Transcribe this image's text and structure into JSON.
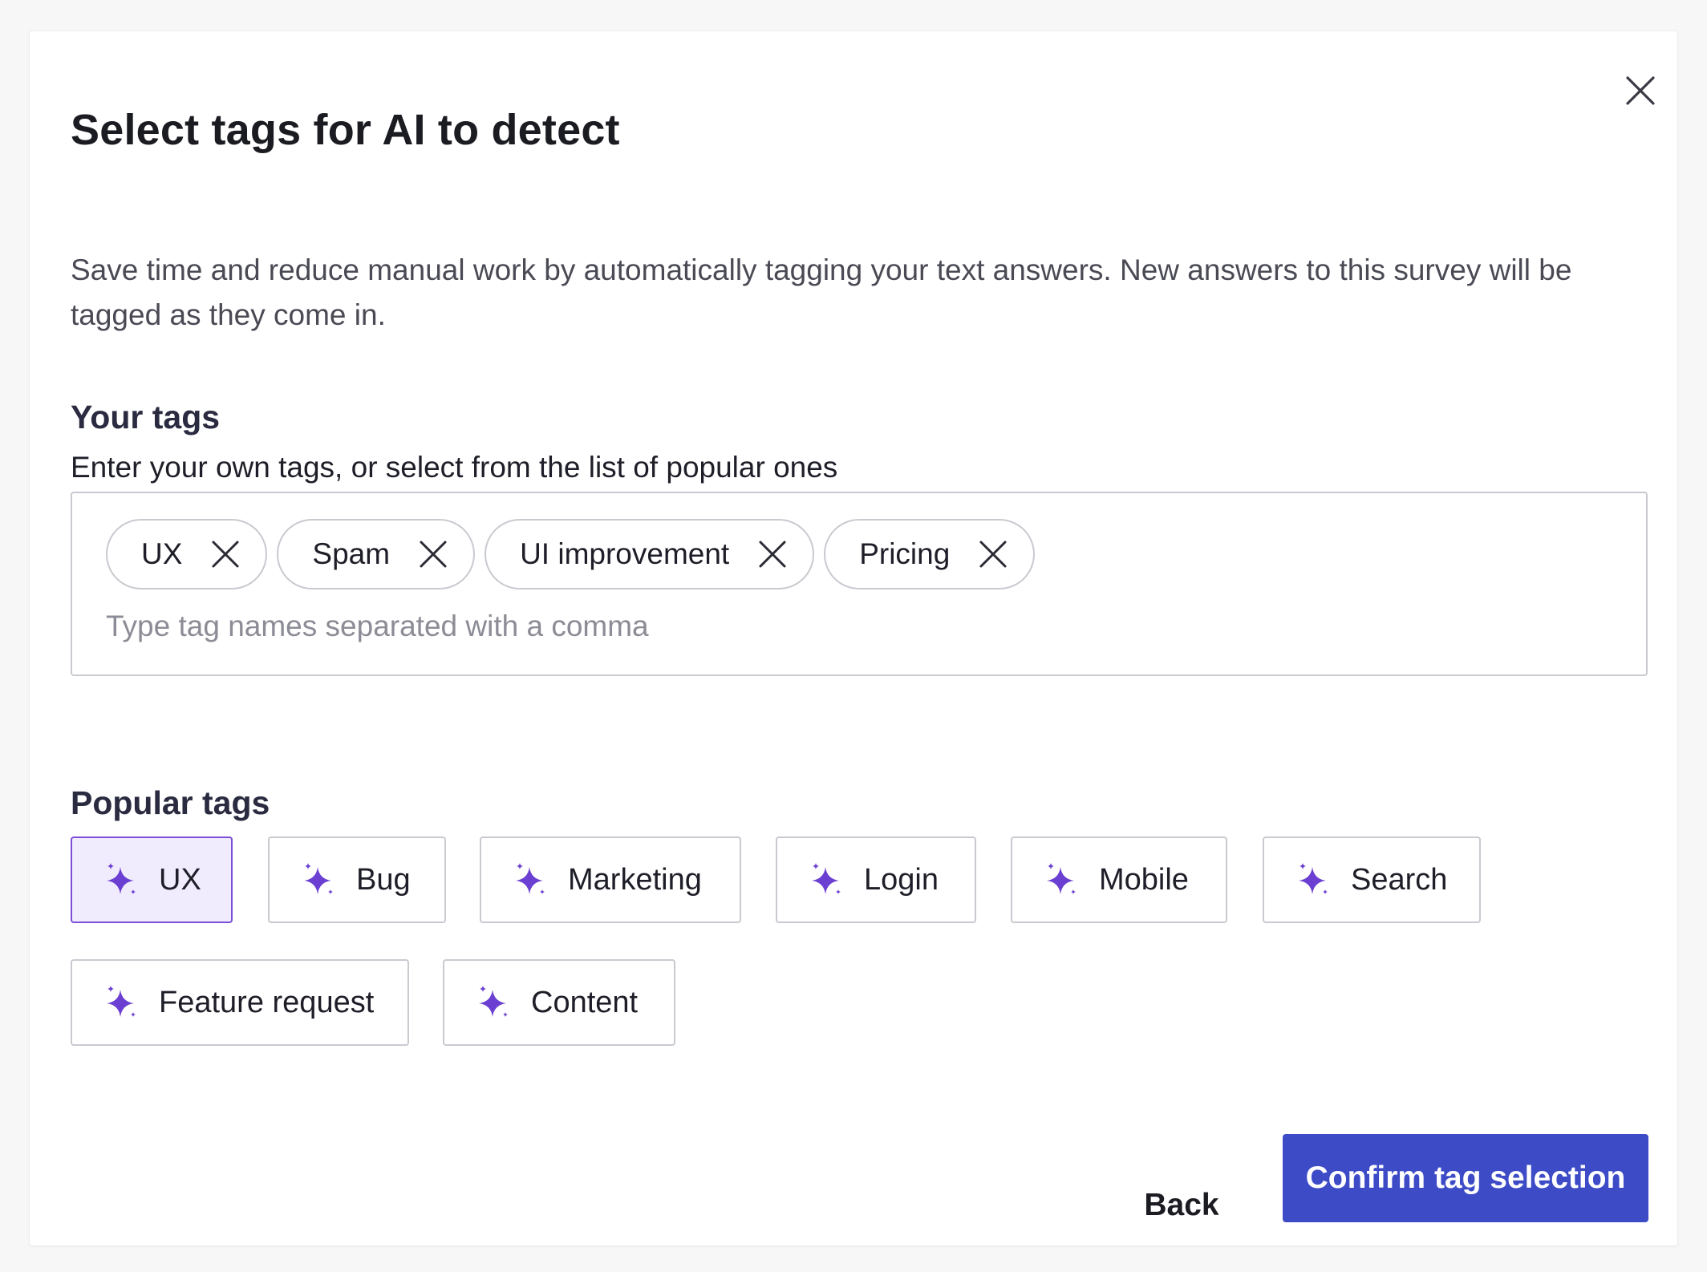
{
  "dialog": {
    "title": "Select tags for AI to detect",
    "description": "Save time and reduce manual work by automatically tagging your text answers. New answers to this survey will be tagged as they come in.",
    "close_icon": "close-icon"
  },
  "your_tags": {
    "heading": "Your tags",
    "subheading": "Enter your own tags, or select from the list of popular ones",
    "chips": [
      "UX",
      "Spam",
      "UI improvement",
      "Pricing"
    ],
    "input_placeholder": "Type tag names separated with a comma",
    "input_value": ""
  },
  "popular_tags": {
    "heading": "Popular tags",
    "icon": "sparkle-icon",
    "items": [
      {
        "label": "UX",
        "selected": true
      },
      {
        "label": "Bug",
        "selected": false
      },
      {
        "label": "Marketing",
        "selected": false
      },
      {
        "label": "Login",
        "selected": false
      },
      {
        "label": "Mobile",
        "selected": false
      },
      {
        "label": "Search",
        "selected": false
      },
      {
        "label": "Feature request",
        "selected": false
      },
      {
        "label": "Content",
        "selected": false
      }
    ]
  },
  "footer": {
    "back_label": "Back",
    "confirm_label": "Confirm tag selection"
  },
  "colors": {
    "accent_blue": "#3d4bc7",
    "sparkle_purple": "#6a3fd1",
    "selected_bg": "#f1ebfe",
    "selected_border": "#7b4ed6",
    "border_gray": "#c9c9d0"
  }
}
